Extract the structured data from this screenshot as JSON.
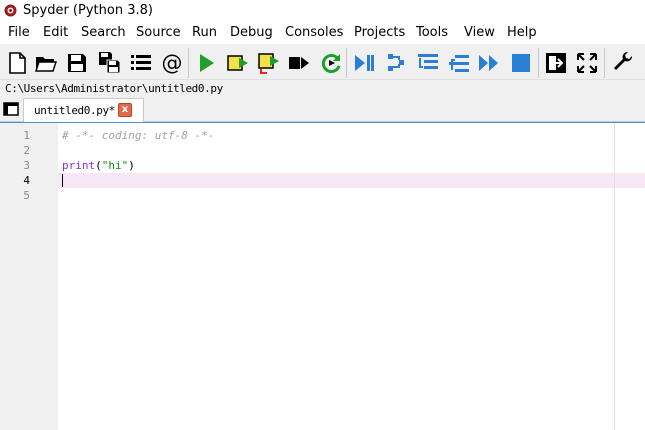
{
  "window": {
    "title": "Spyder (Python 3.8)"
  },
  "menubar": {
    "items": [
      "File",
      "Edit",
      "Search",
      "Source",
      "Run",
      "Debug",
      "Consoles",
      "Projects",
      "Tools",
      "View",
      "Help"
    ]
  },
  "toolbar": {
    "buttons": [
      "new-file-icon",
      "open-file-icon",
      "save-file-icon",
      "save-all-icon",
      "show-list-icon",
      "at-symbol-icon",
      "run-icon",
      "run-cell-icon",
      "run-cell-advance-icon",
      "run-selection-icon",
      "rerun-icon",
      "debug-icon",
      "step-icon",
      "step-into-icon",
      "step-return-icon",
      "continue-icon",
      "stop-icon",
      "maximize-pane-icon",
      "fullscreen-icon",
      "preferences-wrench-icon"
    ],
    "colors": {
      "green": "#1f9e2a",
      "blue": "#2b7fd4",
      "yellow": "#f2e14a",
      "red": "#e32b1a"
    }
  },
  "pathbar": {
    "path": "C:\\Users\\Administrator\\untitled0.py"
  },
  "tabs": {
    "items": [
      {
        "label": "untitled0.py*",
        "close_glyph": "x"
      }
    ]
  },
  "editor": {
    "line_numbers": [
      "1",
      "2",
      "3",
      "4",
      "5"
    ],
    "current_line": 4,
    "lines": {
      "l1_comment": "# -*- coding: utf-8 -*-",
      "l3_fn": "print",
      "l3_open": "(",
      "l3_str": "\"hi\"",
      "l3_close": ")"
    },
    "colors": {
      "comment": "#a0a0a0",
      "builtin": "#8a2be2",
      "string": "#0a8a1a",
      "current_line": "#f7e6f4"
    }
  }
}
